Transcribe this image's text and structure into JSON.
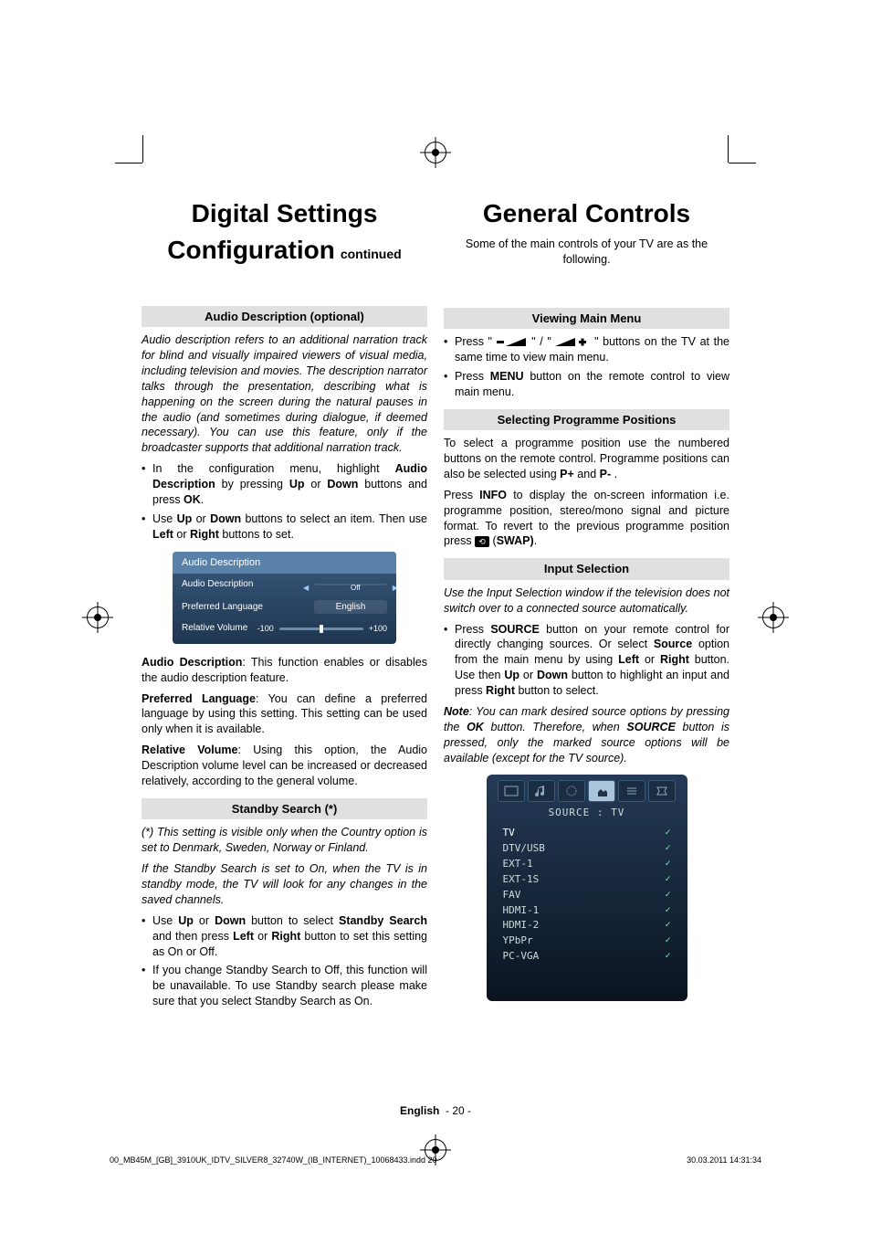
{
  "left": {
    "title_top": "Digital Settings",
    "title_bottom": "Configuration",
    "title_cont": "continued",
    "h_audio": "Audio Description (optional)",
    "audio_intro": "Audio description refers to an additional narration track for blind and visually impaired viewers of visual media, including television and movies. The description narrator talks through the presentation, describing what is happening on the screen during the natural pauses in the audio (and sometimes during dialogue, if deemed necessary). You can use this feature, only if the broadcaster supports that additional narration track.",
    "bullets1": [
      {
        "pre": "In the configuration menu, highlight ",
        "b": "Audio Description",
        "mid": " by pressing ",
        "b2": "Up",
        "mid2": " or ",
        "b3": "Down",
        "post": " buttons and press ",
        "b4": "OK",
        "end": "."
      },
      {
        "pre": "Use ",
        "b": "Up",
        "mid": " or ",
        "b2": "Down",
        "mid2": " buttons to select an item. Then use ",
        "b3": "Left",
        "post": " or ",
        "b4": "Right",
        "end": " buttons to set."
      }
    ],
    "panel": {
      "title": "Audio Description",
      "row1_label": "Audio Description",
      "row1_val": "Off",
      "row2_label": "Preferred Language",
      "row2_val": "English",
      "slider_label": "Relative Volume",
      "slider_min": "-100",
      "slider_max": "+100"
    },
    "para_ad_lead": "Audio Description",
    "para_ad": ": This function enables or disables the audio description feature.",
    "para_pl_lead": "Preferred Language",
    "para_pl": ": You can define a preferred language by using this setting. This setting can be used only when it is available.",
    "para_rv_lead": "Relative Volume",
    "para_rv": ": Using this option, the Audio Description volume level can be increased or decreased relatively, according to the general volume.",
    "h_standby": "Standby Search (*)",
    "standby_note": "(*) This setting is visible only when the Country option is set to Denmark, Sweden, Norway or Finland.",
    "standby_p": "If the Standby Search is set to On, when the TV is in standby mode, the TV will look for any changes in the saved channels.",
    "bullets2": [
      {
        "pre": "Use ",
        "b": "Up",
        "mid": " or ",
        "b2": "Down",
        "mid2": " button to select ",
        "b3": "Standby Search",
        "post": " and then press ",
        "b4": "Left",
        "mid3": " or ",
        "b5": "Right",
        "end": " button to set this setting as On or Off."
      },
      {
        "plain": "If you change Standby Search to Off, this function will be unavailable. To use Standby search please make sure that you select Standby Search as On."
      }
    ]
  },
  "right": {
    "title": "General Controls",
    "intro": "Some of the main controls of your TV are as the following.",
    "h_main": "Viewing Main Menu",
    "bullets_main": [
      {
        "pre": "Press \"",
        "icon": "vol-minus",
        "mid": "\" / \"",
        "icon2": "vol-plus",
        "post": "\" buttons on the TV at the same time to view main menu."
      },
      {
        "pre": "Press ",
        "b": "MENU",
        "post": " button on the remote control to view main menu."
      }
    ],
    "h_prog": "Selecting Programme Positions",
    "prog_p": {
      "pre": "To select a programme position use the numbered buttons on the remote control. Programme positions can also be selected using ",
      "b": "P+",
      "mid": " and ",
      "b2": "P-",
      "post": " ."
    },
    "prog_p2": {
      "pre": "Press ",
      "b": "INFO",
      "mid": " to display the on-screen information i.e. programme position, stereo/mono signal and picture format. To revert to the previous programme position press ",
      "icon": "swap",
      "post": " (",
      "b2": "SWAP)",
      "end": "."
    },
    "h_input": "Input Selection",
    "input_intro": "Use the Input Selection window if the television does not switch over to a connected source automatically.",
    "input_b": {
      "pre": "Press ",
      "b": "SOURCE",
      "mid": " button on your remote control for directly changing sources. Or select ",
      "b2": "Source",
      "mid2": " option from the main menu by using ",
      "b3": "Left",
      "mid3": " or ",
      "b4": "Right",
      "mid4": " button. Use then ",
      "b5": "Up",
      "mid5": " or ",
      "b6": "Down",
      "mid6": " button to highlight an input and press ",
      "b7": "Right",
      "post": " button to select."
    },
    "input_note": {
      "b": "Note",
      "pre": ": You can mark desired source options by pressing the ",
      "b2": "OK",
      "mid": " button. Therefore, when ",
      "b3": "SOURCE",
      "post": " button is pressed, only the marked source options will be available (except for the TV source)."
    },
    "src": {
      "title": "SOURCE : TV",
      "items": [
        "TV",
        "DTV/USB",
        "EXT-1",
        "EXT-1S",
        "FAV",
        "HDMI-1",
        "HDMI-2",
        "YPbPr",
        "PC-VGA"
      ]
    }
  },
  "footer": {
    "lang": "English",
    "page": "- 20 -"
  },
  "folio": {
    "file": "00_MB45M_[GB]_3910UK_IDTV_SILVER8_32740W_(IB_INTERNET)_10068433.indd   20",
    "date": "30.03.2011   14:31:34"
  }
}
